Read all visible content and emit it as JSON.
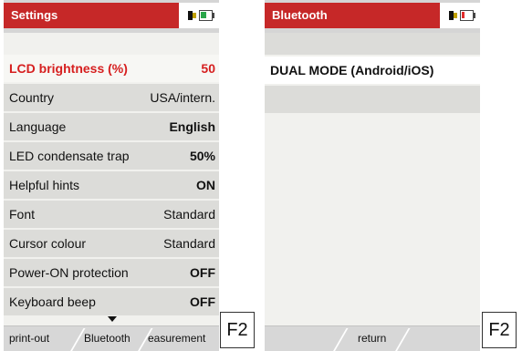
{
  "settings": {
    "title": "Settings",
    "items": [
      {
        "label": "LCD brightness (%)",
        "value": "50"
      },
      {
        "label": "Country",
        "value": "USA/intern."
      },
      {
        "label": "Language",
        "value": "English"
      },
      {
        "label": "LED condensate trap",
        "value": "50%"
      },
      {
        "label": "Helpful hints",
        "value": "ON"
      },
      {
        "label": "Font",
        "value": "Standard"
      },
      {
        "label": "Cursor colour",
        "value": "Standard"
      },
      {
        "label": "Power-ON protection",
        "value": "OFF"
      },
      {
        "label": "Keyboard beep",
        "value": "OFF"
      }
    ],
    "softkeys": [
      "print-out",
      "Bluetooth",
      "easurement"
    ]
  },
  "bluetooth": {
    "title": "Bluetooth",
    "item": "DUAL MODE (Android/iOS)",
    "softkey": "return"
  },
  "fkeys": {
    "left": "F2",
    "right": "F2"
  },
  "colors": {
    "accent": "#c62828",
    "active_text": "#d61f1f",
    "battery_left": "#2aa64a",
    "battery_right": "#e12c2c"
  }
}
